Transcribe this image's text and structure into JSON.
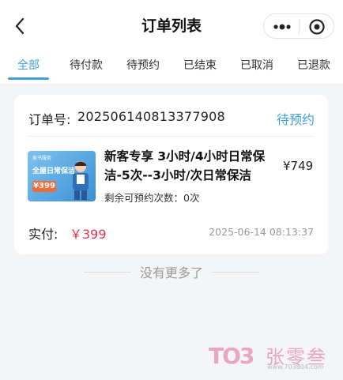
{
  "header": {
    "title": "订单列表"
  },
  "tabs": [
    {
      "label": "全部"
    },
    {
      "label": "待付款"
    },
    {
      "label": "待预约"
    },
    {
      "label": "已结束"
    },
    {
      "label": "已取消"
    },
    {
      "label": "已退款"
    }
  ],
  "active_tab": "全部",
  "order": {
    "number_label": "订单号:",
    "number": "202506140813377908",
    "status": "待预约",
    "product": {
      "name": "新客专享 3小时/4小时日常保洁-5次--3小时/次日常保洁",
      "price": "¥749",
      "remaining": "剩余可预约次数：0次",
      "thumb_small": "家书服务",
      "thumb_title": "全屋日常保洁",
      "thumb_price": "¥399"
    },
    "paid_label": "实付:",
    "paid_value": "￥399",
    "time": "2025-06-14 08:13:37"
  },
  "footer": {
    "no_more": "没有更多了"
  },
  "watermark": {
    "logo": "TO3",
    "name": "张零叁",
    "url": "www.703804.com"
  },
  "colors": {
    "accent": "#3fa0d9",
    "price_red": "#e8334a"
  }
}
